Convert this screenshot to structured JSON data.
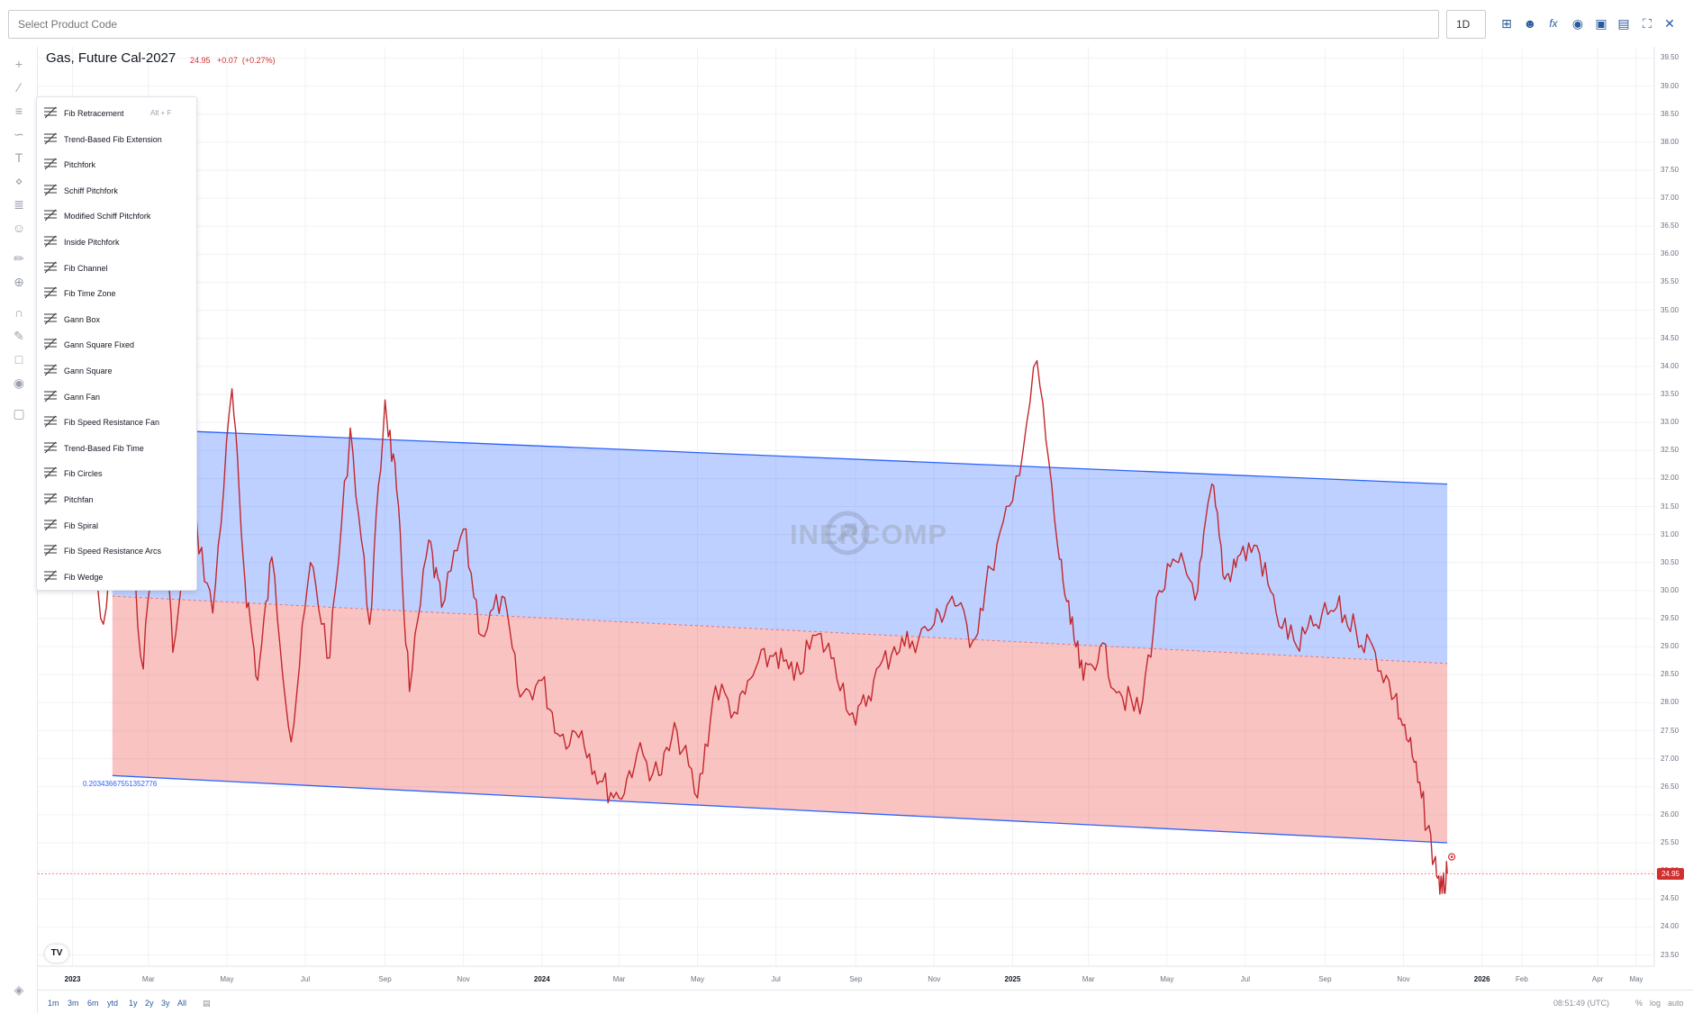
{
  "toolbar": {
    "product_placeholder": "Select Product Code",
    "interval": "1D",
    "icons": [
      "add-icon",
      "compare-icon",
      "indicators-fx-icon",
      "camera-icon",
      "save-image-icon",
      "chart-type-icon",
      "fullscreen-icon",
      "close-icon"
    ]
  },
  "left_tools": [
    "crosshair-icon",
    "trend-line-icon",
    "fib-tool-icon",
    "brush-icon",
    "text-icon",
    "pattern-icon",
    "prediction-icon",
    "emoji-icon",
    "ruler-icon",
    "zoom-icon",
    "magnet-icon",
    "lock-drawing-icon",
    "lock-icon",
    "eye-icon",
    "trash-icon",
    "layers-icon"
  ],
  "chart": {
    "title": "Gas, Future Cal-2027",
    "last_value": "24.95",
    "change": "+0.07",
    "change_pct": "(+0.27%)",
    "fib_level_label": "0.20343667551352776",
    "watermark": "INERCOMP",
    "tv_logo": "TV",
    "last_price_label": "24.95",
    "up_color": "#2962ff",
    "down_color": "#ef5350",
    "line_color": "#c2272d"
  },
  "chart_data": {
    "type": "line",
    "series": [
      {
        "values_x": [
          "2022-12-20",
          "2023-01-10",
          "2023-01-25",
          "2023-02-10",
          "2023-02-25",
          "2023-03-10",
          "2023-03-20",
          "2023-04-05",
          "2023-04-20",
          "2023-05-05",
          "2023-05-15",
          "2023-05-25",
          "2023-06-05",
          "2023-06-20",
          "2023-07-05",
          "2023-07-20",
          "2023-08-05",
          "2023-08-20",
          "2023-09-01",
          "2023-09-10",
          "2023-09-20",
          "2023-10-05",
          "2023-10-15",
          "2023-11-01",
          "2023-11-15",
          "2023-12-01",
          "2023-12-15",
          "2024-01-01",
          "2024-01-15",
          "2024-02-01",
          "2024-02-15",
          "2024-03-01",
          "2024-03-15",
          "2024-04-01",
          "2024-04-15",
          "2024-05-01",
          "2024-05-15",
          "2024-06-01",
          "2024-06-15",
          "2024-07-01",
          "2024-07-15",
          "2024-08-01",
          "2024-08-15",
          "2024-09-01",
          "2024-09-15",
          "2024-10-01",
          "2024-10-15",
          "2024-11-01",
          "2024-11-15",
          "2024-12-01",
          "2024-12-15",
          "2025-01-01",
          "2025-01-20",
          "2025-02-05",
          "2025-02-15",
          "2025-02-25",
          "2025-03-10",
          "2025-03-25",
          "2025-04-10",
          "2025-04-25",
          "2025-05-10",
          "2025-05-25",
          "2025-06-05",
          "2025-06-15",
          "2025-06-25",
          "2025-07-10",
          "2025-07-25",
          "2025-08-10",
          "2025-08-25",
          "2025-09-10",
          "2025-09-25",
          "2025-10-10",
          "2025-10-25",
          "2025-11-05",
          "2025-11-15",
          "2025-11-25",
          "2025-12-01",
          "2025-12-05"
        ],
        "values_y": [
          30.1,
          31.2,
          29.4,
          32.1,
          28.6,
          32.8,
          28.9,
          31.4,
          29.6,
          33.6,
          30.2,
          28.4,
          30.6,
          27.3,
          30.5,
          28.8,
          32.9,
          29.4,
          33.4,
          31.8,
          28.2,
          30.9,
          29.7,
          31.1,
          29.2,
          29.9,
          28.1,
          28.4,
          27.4,
          27.5,
          26.6,
          26.3,
          27.1,
          26.7,
          27.5,
          26.3,
          28.3,
          27.8,
          28.6,
          28.9,
          28.4,
          29.2,
          28.8,
          27.6,
          28.4,
          29.0,
          29.1,
          29.4,
          29.9,
          29.1,
          30.4,
          31.6,
          34.1,
          30.8,
          29.4,
          28.4,
          29.0,
          28.2,
          27.8,
          30.0,
          30.5,
          30.0,
          31.9,
          30.2,
          30.6,
          30.8,
          29.6,
          29.0,
          29.4,
          29.7,
          29.3,
          28.9,
          28.1,
          27.3,
          26.3,
          25.2,
          24.6,
          24.95
        ]
      }
    ],
    "ylim": [
      23.3,
      39.7
    ],
    "y_ticks": [
      "39.50",
      "39.00",
      "38.50",
      "38.00",
      "37.50",
      "37.00",
      "36.50",
      "36.00",
      "35.50",
      "35.00",
      "34.50",
      "34.00",
      "33.50",
      "33.00",
      "32.50",
      "32.00",
      "31.50",
      "31.00",
      "30.50",
      "30.00",
      "29.50",
      "29.00",
      "28.50",
      "28.00",
      "27.50",
      "27.00",
      "26.50",
      "26.00",
      "25.50",
      "25.00",
      "24.50",
      "24.00",
      "23.50"
    ],
    "x_ticks": [
      {
        "label": "2023",
        "major": true
      },
      {
        "label": "Mar",
        "major": false
      },
      {
        "label": "May",
        "major": false
      },
      {
        "label": "Jul",
        "major": false
      },
      {
        "label": "Sep",
        "major": false
      },
      {
        "label": "Nov",
        "major": false
      },
      {
        "label": "2024",
        "major": true
      },
      {
        "label": "Mar",
        "major": false
      },
      {
        "label": "May",
        "major": false
      },
      {
        "label": "Jul",
        "major": false
      },
      {
        "label": "Sep",
        "major": false
      },
      {
        "label": "Nov",
        "major": false
      },
      {
        "label": "2025",
        "major": true
      },
      {
        "label": "Mar",
        "major": false
      },
      {
        "label": "May",
        "major": false
      },
      {
        "label": "Jul",
        "major": false
      },
      {
        "label": "Sep",
        "major": false
      },
      {
        "label": "Nov",
        "major": false
      },
      {
        "label": "2026",
        "major": true
      },
      {
        "label": "Feb",
        "major": false
      },
      {
        "label": "Apr",
        "major": false
      },
      {
        "label": "May",
        "major": false
      }
    ],
    "fib_channel": {
      "upper_start": 32.9,
      "upper_end": 31.9,
      "mid_start": 29.9,
      "mid_end": 28.7,
      "lower_start": 26.7,
      "lower_end": 25.5,
      "start": "2023-02-01",
      "end": "2025-12-05"
    }
  },
  "fib_menu": {
    "items": [
      {
        "label": "Fib Retracement",
        "hotkey": "Alt + F",
        "icon": "fib-retracement-icon"
      },
      {
        "label": "Trend-Based Fib Extension",
        "hotkey": "",
        "icon": "trend-fib-extension-icon"
      },
      {
        "label": "Pitchfork",
        "hotkey": "",
        "icon": "pitchfork-icon"
      },
      {
        "label": "Schiff Pitchfork",
        "hotkey": "",
        "icon": "schiff-pitchfork-icon"
      },
      {
        "label": "Modified Schiff Pitchfork",
        "hotkey": "",
        "icon": "modified-schiff-pitchfork-icon"
      },
      {
        "label": "Inside Pitchfork",
        "hotkey": "",
        "icon": "inside-pitchfork-icon"
      },
      {
        "label": "Fib Channel",
        "hotkey": "",
        "icon": "fib-channel-icon"
      },
      {
        "label": "Fib Time Zone",
        "hotkey": "",
        "icon": "fib-time-zone-icon"
      },
      {
        "label": "Gann Box",
        "hotkey": "",
        "icon": "gann-box-icon"
      },
      {
        "label": "Gann Square Fixed",
        "hotkey": "",
        "icon": "gann-square-fixed-icon"
      },
      {
        "label": "Gann Square",
        "hotkey": "",
        "icon": "gann-square-icon"
      },
      {
        "label": "Gann Fan",
        "hotkey": "",
        "icon": "gann-fan-icon"
      },
      {
        "label": "Fib Speed Resistance Fan",
        "hotkey": "",
        "icon": "fib-speed-fan-icon"
      },
      {
        "label": "Trend-Based Fib Time",
        "hotkey": "",
        "icon": "trend-fib-time-icon"
      },
      {
        "label": "Fib Circles",
        "hotkey": "",
        "icon": "fib-circles-icon"
      },
      {
        "label": "Pitchfan",
        "hotkey": "",
        "icon": "pitchfan-icon"
      },
      {
        "label": "Fib Spiral",
        "hotkey": "",
        "icon": "fib-spiral-icon"
      },
      {
        "label": "Fib Speed Resistance Arcs",
        "hotkey": "",
        "icon": "fib-speed-arcs-icon"
      },
      {
        "label": "Fib Wedge",
        "hotkey": "",
        "icon": "fib-wedge-icon"
      }
    ]
  },
  "bottom": {
    "ranges": [
      "1m",
      "3m",
      "6m",
      "ytd",
      "1y",
      "2y",
      "3y",
      "All"
    ],
    "clock": "08:51:49 (UTC)",
    "pct": "%",
    "log": "log",
    "auto": "auto"
  }
}
